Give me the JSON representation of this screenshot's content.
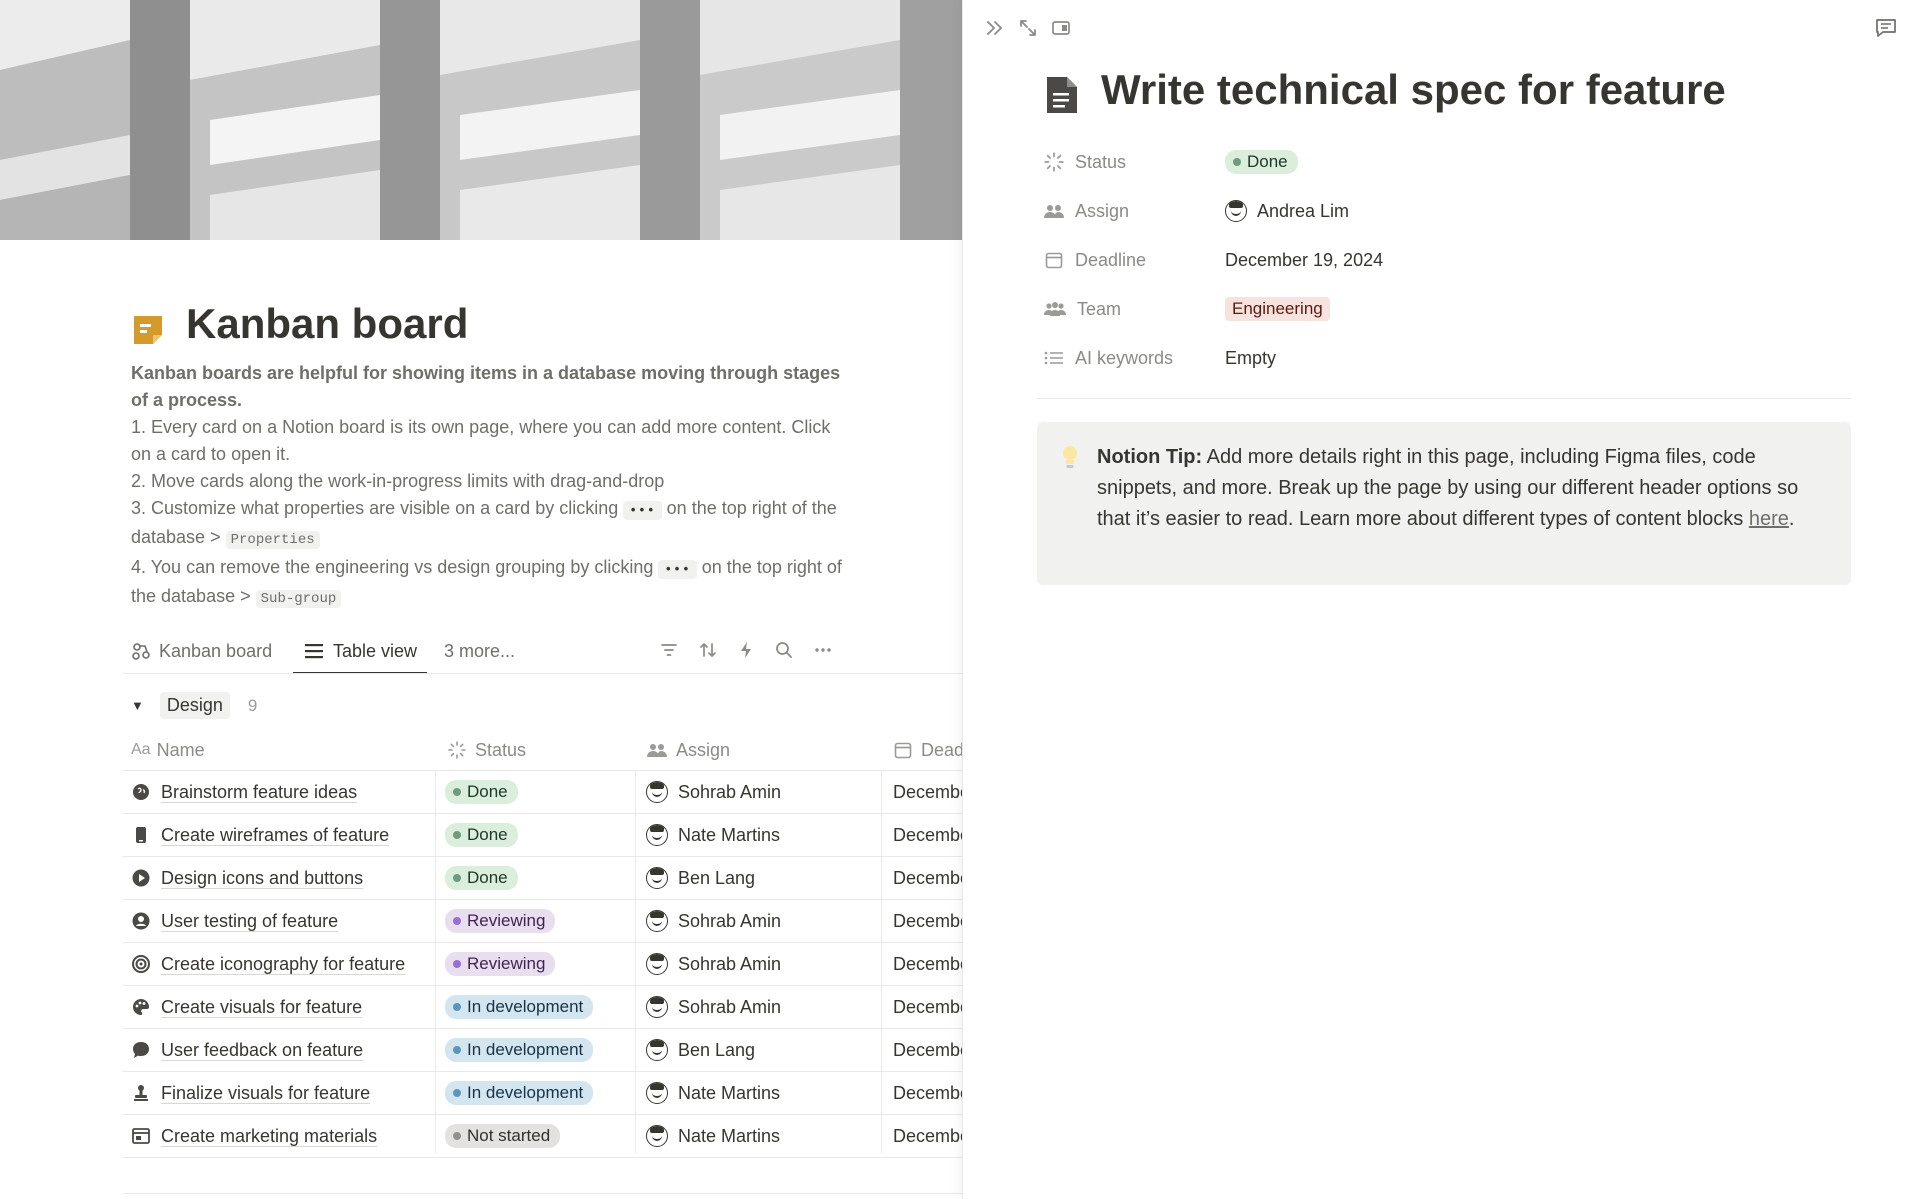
{
  "page": {
    "title": "Kanban board",
    "intro": "Kanban boards are helpful for showing items in a database moving through stages of a process.",
    "steps": [
      "1. Every card on a Notion board is its own page, where you can add more content. Click on a card to open it.",
      "2. Move cards along the work-in-progress limits with drag-and-drop",
      "3. Customize what properties are visible on a card by clicking",
      "on the top right of the database",
      "4. You can remove the engineering vs design grouping by clicking",
      "on the top right of the database"
    ],
    "dots_code": "•••",
    "step3_code": "Properties",
    "step4_code": "Sub-group",
    "arrow": ">"
  },
  "views": {
    "tab_kanban": "Kanban board",
    "tab_table": "Table view",
    "tab_more": "3 more..."
  },
  "group": {
    "label": "Design",
    "count": "9"
  },
  "columns": {
    "name": "Name",
    "status": "Status",
    "assign": "Assign",
    "deadline": "Dead"
  },
  "rows": [
    {
      "name": "Brainstorm feature ideas",
      "icon": "brain-icon",
      "status": "Done",
      "assign": "Sohrab Amin",
      "deadline": "December"
    },
    {
      "name": "Create wireframes of feature",
      "icon": "phone-icon",
      "status": "Done",
      "assign": "Nate Martins",
      "deadline": "December"
    },
    {
      "name": "Design icons and buttons",
      "icon": "play-icon",
      "status": "Done",
      "assign": "Ben Lang",
      "deadline": "December"
    },
    {
      "name": "User testing of feature",
      "icon": "user-circle-icon",
      "status": "Reviewing",
      "assign": "Sohrab Amin",
      "deadline": "December"
    },
    {
      "name": "Create iconography for feature",
      "icon": "target-icon",
      "status": "Reviewing",
      "assign": "Sohrab Amin",
      "deadline": "December"
    },
    {
      "name": "Create visuals for feature",
      "icon": "palette-icon",
      "status": "In development",
      "assign": "Sohrab Amin",
      "deadline": "December"
    },
    {
      "name": "User feedback on feature",
      "icon": "chat-bubble-icon",
      "status": "In development",
      "assign": "Ben Lang",
      "deadline": "December"
    },
    {
      "name": "Finalize visuals for feature",
      "icon": "stamp-icon",
      "status": "In development",
      "assign": "Nate Martins",
      "deadline": "December"
    },
    {
      "name": "Create marketing materials",
      "icon": "browser-icon",
      "status": "Not started",
      "assign": "Nate Martins",
      "deadline": "December"
    }
  ],
  "status_colors": {
    "Done": {
      "bg": "#dbeddb",
      "dot": "#6c9b7d",
      "text": "#1c3829"
    },
    "Reviewing": {
      "bg": "#e8deee",
      "dot": "#9a6dd7",
      "text": "#412454"
    },
    "In development": {
      "bg": "#d3e5ef",
      "dot": "#5b97bd",
      "text": "#183347"
    },
    "Not started": {
      "bg": "#e3e2e0",
      "dot": "#91918e",
      "text": "#32302c"
    }
  },
  "peek": {
    "title": "Write technical spec for feature",
    "props": {
      "status_label": "Status",
      "status_value": "Done",
      "assign_label": "Assign",
      "assign_value": "Andrea Lim",
      "deadline_label": "Deadline",
      "deadline_value": "December 19, 2024",
      "team_label": "Team",
      "team_value": "Engineering",
      "ai_label": "AI keywords",
      "ai_value": "Empty"
    },
    "callout": {
      "bold": "Notion Tip:",
      "text": " Add more details right in this page, including Figma files, code snippets, and more. Break up the page by using our different header options so that it’s easier to read. Learn more about different types of content blocks ",
      "link": "here",
      "end": "."
    }
  }
}
